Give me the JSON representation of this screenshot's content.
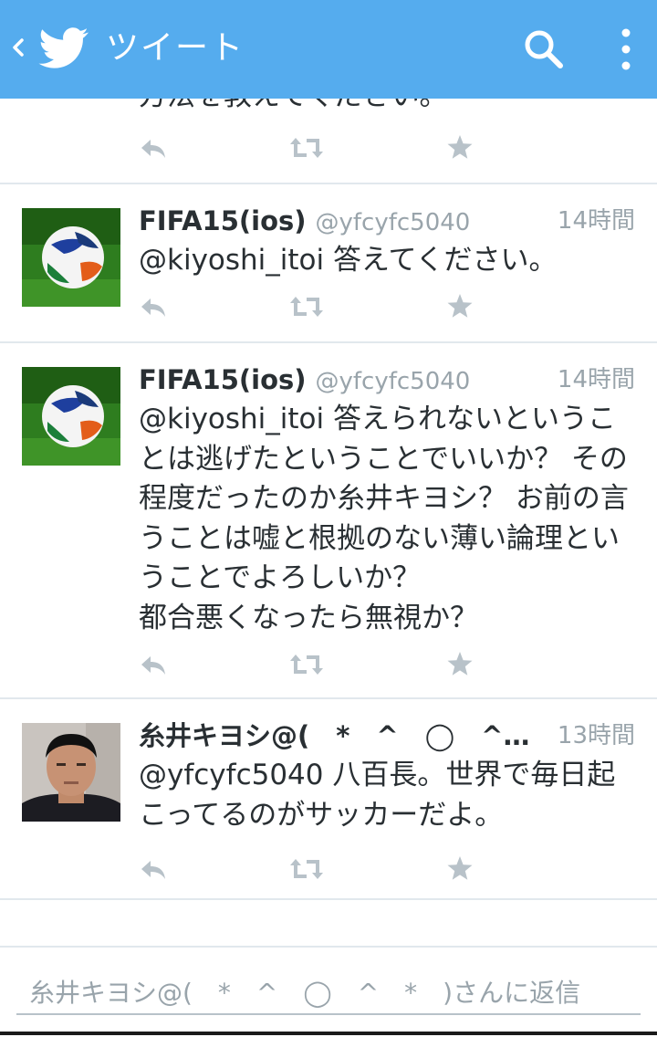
{
  "header": {
    "title": "ツイート",
    "back_icon": "chevron-left-icon",
    "logo_icon": "twitter-bird-icon",
    "search_icon": "search-icon",
    "menu_icon": "overflow-menu-icon",
    "color": "#55acee"
  },
  "tweets": [
    {
      "name": "",
      "handle": "",
      "time": "",
      "text": "方法を教えてください。",
      "truncated_top": true
    },
    {
      "name": "FIFA15(ios)",
      "handle": "@yfcyfc5040",
      "time": "14時間",
      "text": "@kiyoshi_itoi 答えてください。",
      "avatar": "soccer-ball-avatar"
    },
    {
      "name": "FIFA15(ios)",
      "handle": "@yfcyfc5040",
      "time": "14時間",
      "text": "@kiyoshi_itoi 答えられないということは逃げたということでいいか？ その程度だったのか糸井キヨシ？ お前の言うことは嘘と根拠のない薄い論理ということでよろしいか？\n都合悪くなったら無視か？",
      "avatar": "soccer-ball-avatar"
    },
    {
      "name": "糸井キヨシ@(　*　^　◯　^…",
      "handle": "",
      "time": "13時間",
      "text": "@yfcyfc5040 八百長。世界で毎日起こってるのがサッカーだよ。",
      "avatar": "person-photo-avatar"
    }
  ],
  "actions": {
    "reply_icon": "reply-icon",
    "retweet_icon": "retweet-icon",
    "favorite_icon": "star-icon"
  },
  "compose": {
    "placeholder": "糸井キヨシ@(　*　^　◯　^　*　)さんに返信"
  }
}
